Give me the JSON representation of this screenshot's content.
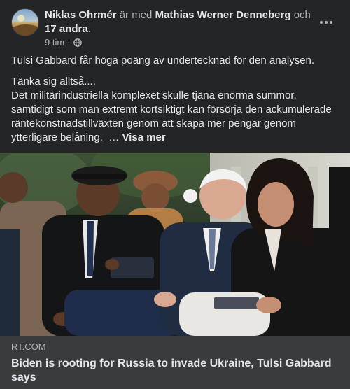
{
  "header": {
    "author": "Niklas Ohrmér",
    "with_text": "är med",
    "tagged": "Mathias Werner Denneberg",
    "and_text": "och",
    "others": "17 andra",
    "period": ".",
    "time": "9 tim",
    "dot": "·",
    "privacy_icon": "globe-icon",
    "menu_icon": "more-horizontal-icon"
  },
  "post": {
    "line1": "Tulsi Gabbard får höga poäng av undertecknad för den analysen.",
    "line2": "Tänka sig alltså....",
    "line3": "Det militärindustriella komplexet skulle tjäna enorma summor, samtidigt som man extremt kortsiktigt kan försörja den ackumulerade räntekonstnadstillväxten genom att skapa mer pengar genom ytterligare belåning.",
    "ellipsis": "…",
    "see_more": "Visa mer"
  },
  "link": {
    "domain": "RT.COM",
    "title": "Biden is rooting for Russia to invade Ukraine, Tulsi Gabbard says"
  },
  "colors": {
    "background": "#242526",
    "link_card": "#3a3b3c",
    "text": "#e4e6eb",
    "muted": "#b0b3b8"
  }
}
